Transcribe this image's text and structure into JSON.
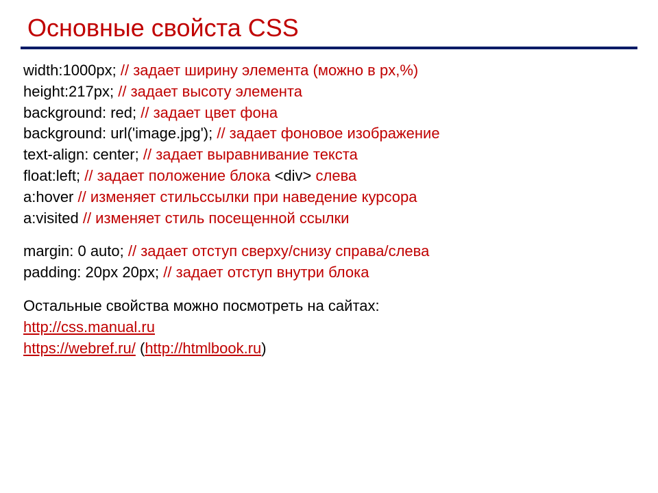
{
  "title": "Основные свойста CSS",
  "lines": {
    "l1": {
      "code": "width:1000px; ",
      "comment": "// задает ширину элемента (можно в px,%)"
    },
    "l2": {
      "code": "height:217px; ",
      "comment": "// задает высоту элемента"
    },
    "l3": {
      "code": "background: red; ",
      "comment": "// задает цвет фона"
    },
    "l4": {
      "code": "background: url('image.jpg'); ",
      "comment": "// задает фоновое изображение"
    },
    "l5": {
      "code": "text-align: center; ",
      "comment": "// задает выравнивание текста"
    },
    "l6": {
      "code": "float:left; ",
      "comment_a": "// задает положение блока ",
      "tag": "<div>",
      "comment_b": " слева"
    },
    "l7": {
      "code": "a:hover ",
      "comment": "// изменяет стильссылки при наведение курсора"
    },
    "l8": {
      "code": "a:visited ",
      "comment": "// изменяет стиль посещенной ссылки"
    },
    "l9": {
      "code": "margin: 0 auto;  ",
      "comment": "// задает отступ сверху/снизу справа/слева"
    },
    "l10": {
      "code": "padding: 20px 20px; ",
      "comment": "// задает отступ внутри блока"
    }
  },
  "footer": {
    "intro": "Остальные свойства можно посмотреть на сайтах:",
    "link1": "http://css.manual.ru",
    "link2": "https://webref.ru/",
    "paren_open": "  (",
    "link3": "http://htmlbook.ru",
    "paren_close": ")"
  }
}
